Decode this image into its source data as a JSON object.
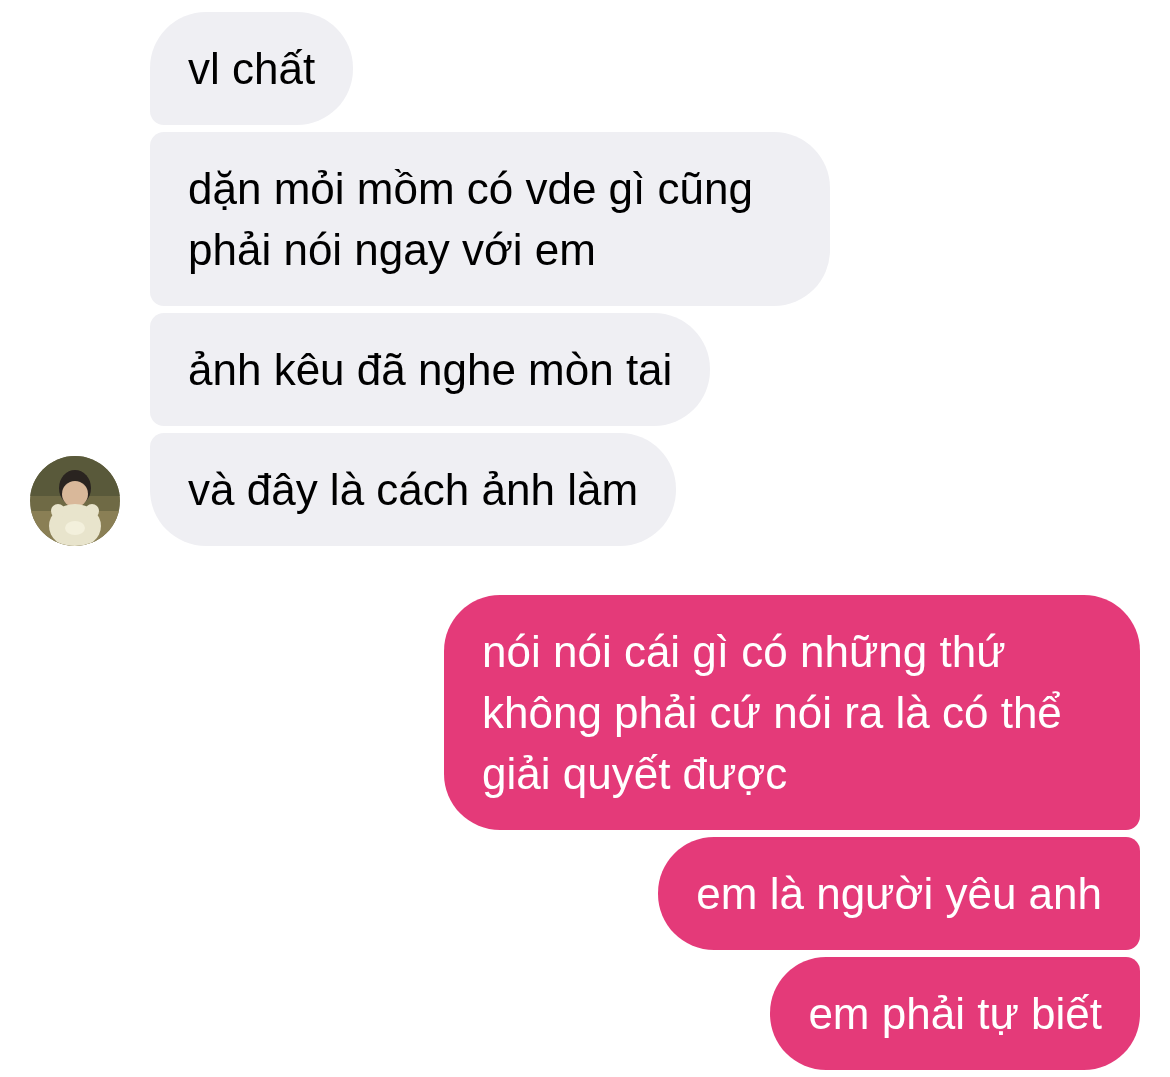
{
  "messages": [
    {
      "kind": "incoming",
      "text": "vl chất"
    },
    {
      "kind": "incoming",
      "text": "dặn mỏi mồm có vde gì cũng phải nói ngay với em"
    },
    {
      "kind": "incoming",
      "text": "ảnh kêu đã nghe mòn tai"
    },
    {
      "kind": "incoming",
      "text": "và đây là cách ảnh làm"
    },
    {
      "kind": "outgoing",
      "text": "nói nói cái gì có những thứ không phải cứ nói ra là có thể giải quyết được"
    },
    {
      "kind": "outgoing",
      "text": "em là người yêu anh"
    },
    {
      "kind": "outgoing",
      "text": "em phải tự biết"
    }
  ]
}
